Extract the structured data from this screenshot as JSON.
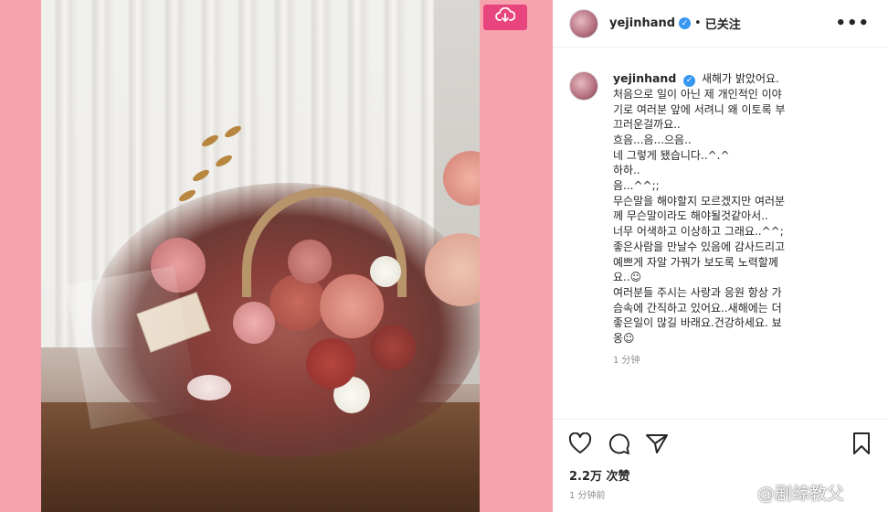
{
  "post": {
    "username": "yejinhand",
    "verified_mark": "✓",
    "separator": "•",
    "follow_status": "已关注",
    "more_icon": "•••"
  },
  "caption": {
    "username": "yejinhand",
    "lines": [
      "새해가 밝았어요.",
      "처음으로 일이 아닌 제 개인적인 이야",
      "기로 여러분 앞에 서려니 왜 이토록 부",
      "끄러운걸까요..",
      "흐음...음...으음..",
      "네 그렇게 됐습니다..^.^",
      "하하..",
      "음...^^;;",
      "무슨말을 해야할지 모르겠지만 여러분",
      "께 무슨말이라도 해야될것같아서..",
      "너무 어색하고 이상하고 그래요..^^;",
      "좋은사람을 만날수 있음에 감사드리고",
      "예쁘게 자알 가꿔가 보도록 노력할께",
      "요..☺",
      "여러분들 주시는 사랑과 응원 항상 가",
      "슴속에 간직하고 있어요..새해에는 더",
      "좋은일이 많길 바래요.건강하세요. 뵤",
      "옹☺"
    ],
    "time_ago": "1 分钟"
  },
  "actions": {
    "like_icon": "heart-icon",
    "comment_icon": "comment-icon",
    "share_icon": "share-icon",
    "save_icon": "bookmark-icon"
  },
  "likes": "2.2万 次赞",
  "post_time": "1 分钟前",
  "watermark": "@剧综教父",
  "colors": {
    "background_pink": "#f6a3ae",
    "download_button": "#e8457e",
    "verified_blue": "#3897f0"
  }
}
